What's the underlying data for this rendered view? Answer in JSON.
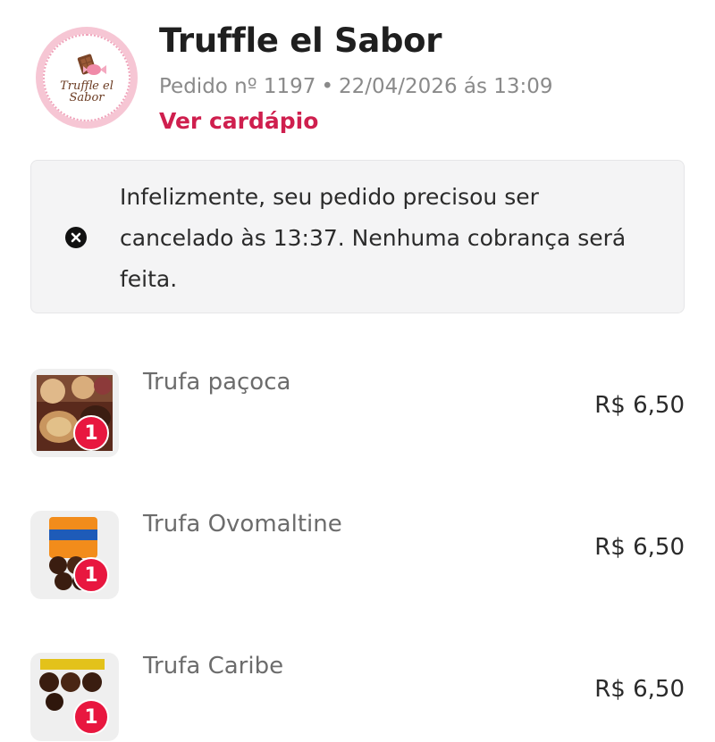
{
  "store": {
    "logo_text": "Truffle el\nSabor",
    "name": "Truffle el Sabor",
    "order_number": "Pedido nº 1197",
    "separator": "•",
    "order_datetime": "22/04/2026 ás 13:09",
    "menu_link": "Ver cardápio"
  },
  "notice": {
    "icon": "close-circle-icon",
    "text": "Infelizmente, seu pedido precisou ser cancelado às 13:37. Nenhuma cobrança será feita."
  },
  "items": [
    {
      "name": "Trufa paçoca",
      "qty": "1",
      "price": "R$ 6,50"
    },
    {
      "name": "Trufa Ovomaltine",
      "qty": "1",
      "price": "R$ 6,50"
    },
    {
      "name": "Trufa Caribe",
      "qty": "1",
      "price": "R$ 6,50"
    }
  ],
  "colors": {
    "accent": "#cf1f4e",
    "badge": "#e8173f",
    "notice_bg": "#f4f4f5"
  }
}
